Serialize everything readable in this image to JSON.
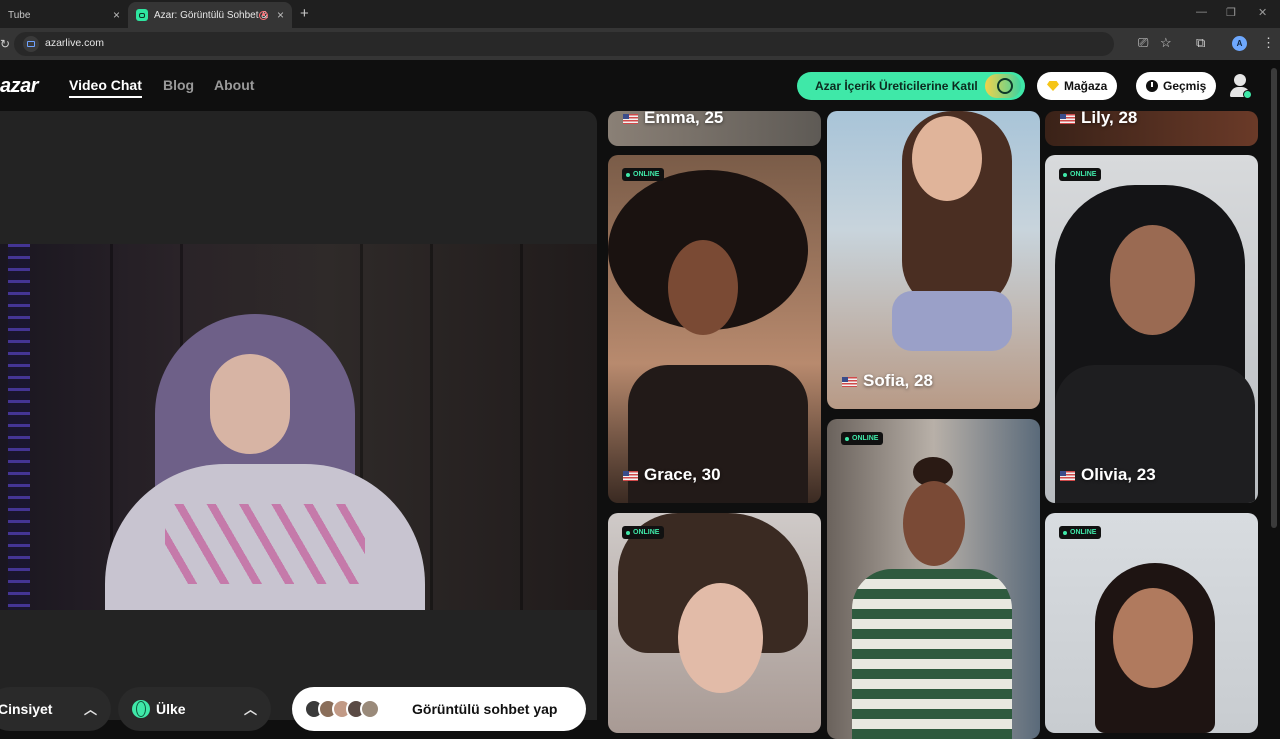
{
  "browser": {
    "tabs": [
      {
        "label": "Tube",
        "active": false
      },
      {
        "label": "Azar: Görüntülü Sohbet & V",
        "active": true
      }
    ],
    "url": "azarlive.com",
    "profile_initial": "A",
    "icons": {
      "close": "×",
      "new_tab": "+",
      "minimize": "—",
      "restore": "❐",
      "close_window": "✕",
      "back": "❯",
      "cast": "⎚",
      "star": "☆",
      "extensions": "⧉",
      "menu": "⋮"
    }
  },
  "site": {
    "logo": "azar",
    "nav": [
      {
        "label": "Video Chat",
        "active": true
      },
      {
        "label": "Blog",
        "active": false
      },
      {
        "label": "About",
        "active": false
      }
    ],
    "creator_button": "Azar İçerik Üreticilerine Katıl",
    "shop_button": "Mağaza",
    "history_button": "Geçmiş",
    "accent_color": "#3fe8a8"
  },
  "controls": {
    "gender_label": "Cinsiyet",
    "country_label": "Ülke",
    "chevron": "︿",
    "start_label": "Görüntülü sohbet yap"
  },
  "profiles": {
    "online_label": "ONLINE",
    "items": [
      {
        "name": "Emma, 25",
        "online": false
      },
      {
        "name": "Lily, 28",
        "online": false
      },
      {
        "name": "Grace, 30",
        "online": true
      },
      {
        "name": "Sofia, 28",
        "online": false
      },
      {
        "name": "Olivia, 23",
        "online": true
      },
      {
        "name": "",
        "online": true
      },
      {
        "name": "",
        "online": true
      },
      {
        "name": "",
        "online": true
      }
    ]
  }
}
